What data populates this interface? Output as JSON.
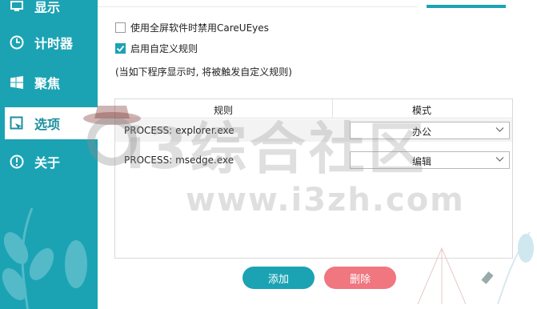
{
  "sidebar": {
    "items": [
      {
        "label": "显示",
        "icon": "monitor-icon"
      },
      {
        "label": "计时器",
        "icon": "clock-icon"
      },
      {
        "label": "聚焦",
        "icon": "windows-icon"
      },
      {
        "label": "选项",
        "icon": "checkbox-edit-icon",
        "active": true
      },
      {
        "label": "关于",
        "icon": "info-icon"
      }
    ]
  },
  "options": {
    "fullscreen_disable": {
      "label": "使用全屏软件时禁用CareUEyes",
      "checked": false
    },
    "custom_rules": {
      "label": "启用自定义规则",
      "checked": true
    },
    "hint": "(当如下程序显示时, 将被触发自定义规则)"
  },
  "table": {
    "columns": [
      "规则",
      "模式"
    ],
    "rows": [
      {
        "rule": "PROCESS: explorer.exe",
        "mode": "办公"
      },
      {
        "rule": "PROCESS: msedge.exe",
        "mode": "编辑"
      }
    ]
  },
  "buttons": {
    "add": "添加",
    "delete": "删除"
  },
  "watermark": {
    "line1": "i3综合社区",
    "line2": "www.i3zh.com"
  },
  "colors": {
    "accent": "#1ba3b4",
    "danger": "#f07680"
  }
}
